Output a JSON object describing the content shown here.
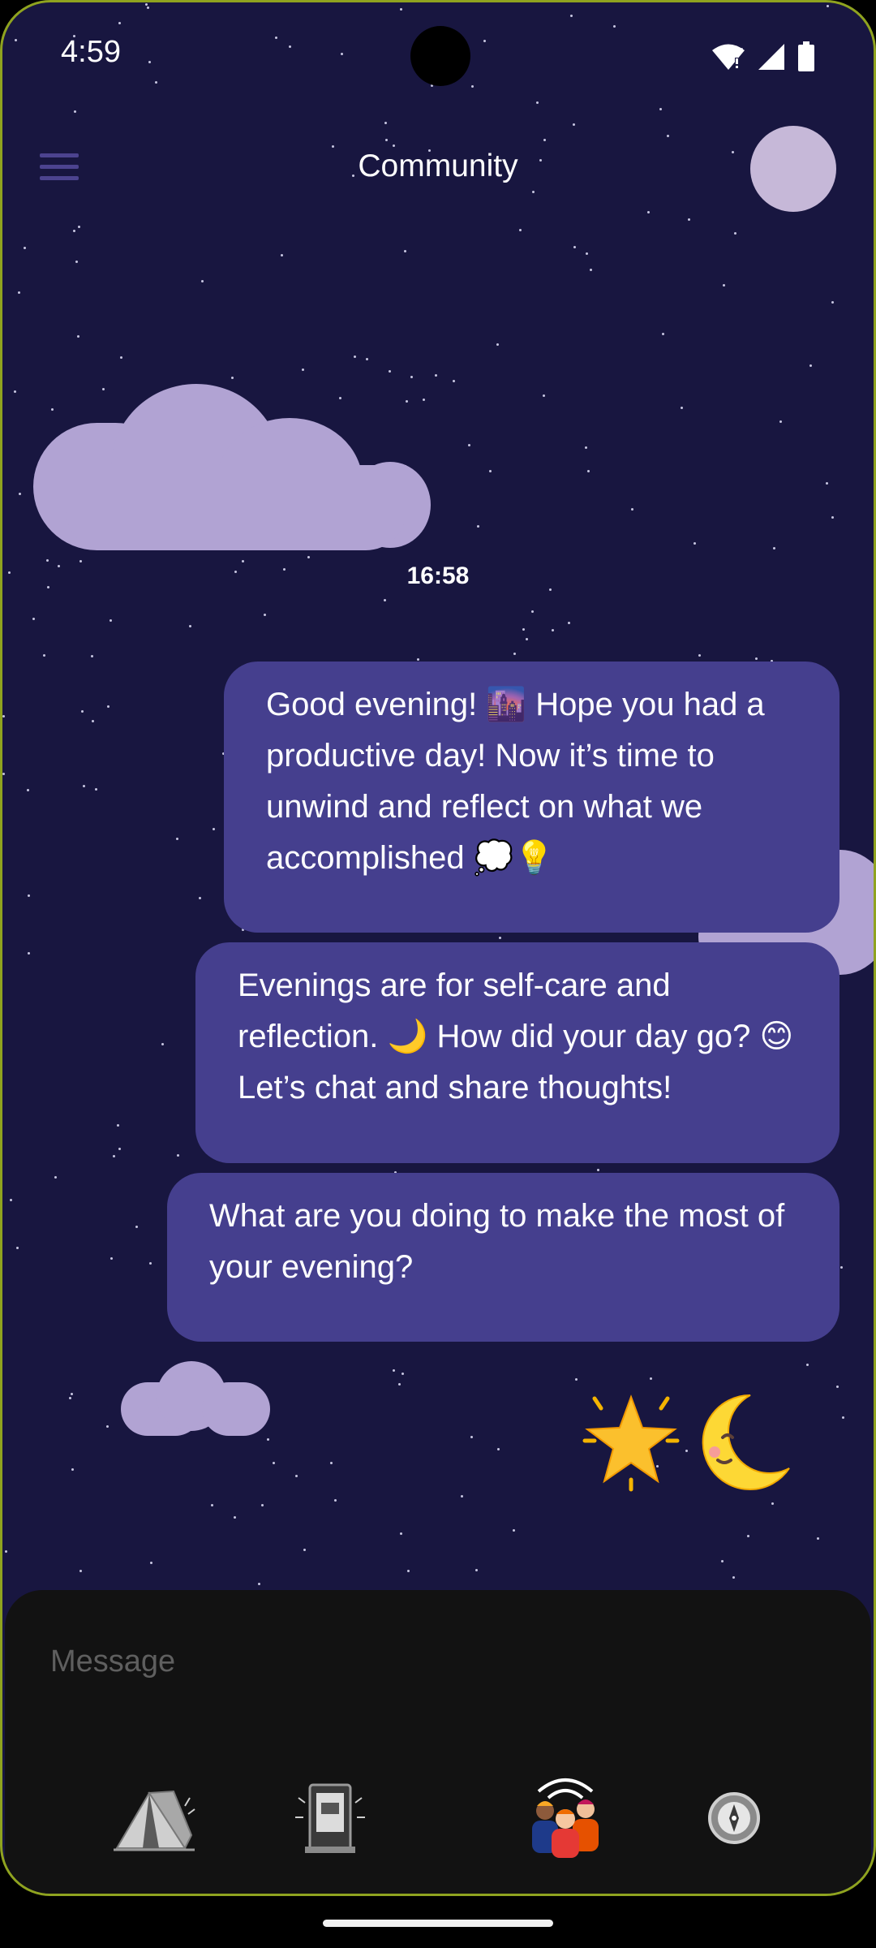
{
  "status_bar": {
    "time": "4:59",
    "icons": [
      "wifi-icon",
      "signal-icon",
      "battery-icon"
    ]
  },
  "header": {
    "title": "Community",
    "menu_icon": "hamburger-menu-icon",
    "avatar": "profile-avatar"
  },
  "chat": {
    "timestamp": "16:58",
    "messages": [
      {
        "text": "Good evening! 🌆 Hope you had a productive day! Now it’s time to unwind and reflect on what we accomplished 💭💡"
      },
      {
        "text": "Evenings are for self-care and reflection. 🌙 How did your day go? 😊 Let’s chat and share thoughts!"
      },
      {
        "text": "What are you doing to make the most of your evening?"
      }
    ],
    "emoji_reaction": [
      "star-emoji",
      "crescent-moon-face-emoji"
    ]
  },
  "composer": {
    "placeholder": "Message",
    "value": ""
  },
  "bottom_nav": {
    "items": [
      "camp-tent-icon",
      "phone-booth-icon",
      "community-people-icon",
      "compass-icon"
    ],
    "active_index": 2
  },
  "colors": {
    "background": "#181640",
    "bubble": "#453f8e",
    "cloud": "#b1a3d3",
    "composer": "#121212",
    "avatar": "#c6b8d8"
  }
}
